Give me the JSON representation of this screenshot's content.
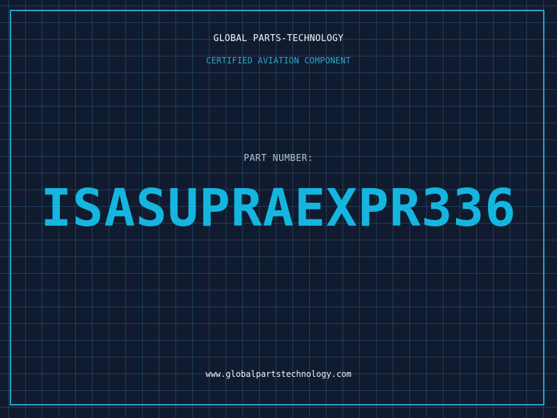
{
  "header": {
    "company": "GLOBAL PARTS-TECHNOLOGY",
    "subtitle": "CERTIFIED AVIATION COMPONENT"
  },
  "part": {
    "label": "PART NUMBER:",
    "number": "ISASUPRAEXPR336"
  },
  "footer": {
    "website": "www.globalpartstechnology.com"
  },
  "colors": {
    "background": "#111b2f",
    "grid": "#2a5c78",
    "accent": "#14b6df",
    "frame": "#29a3c8"
  }
}
